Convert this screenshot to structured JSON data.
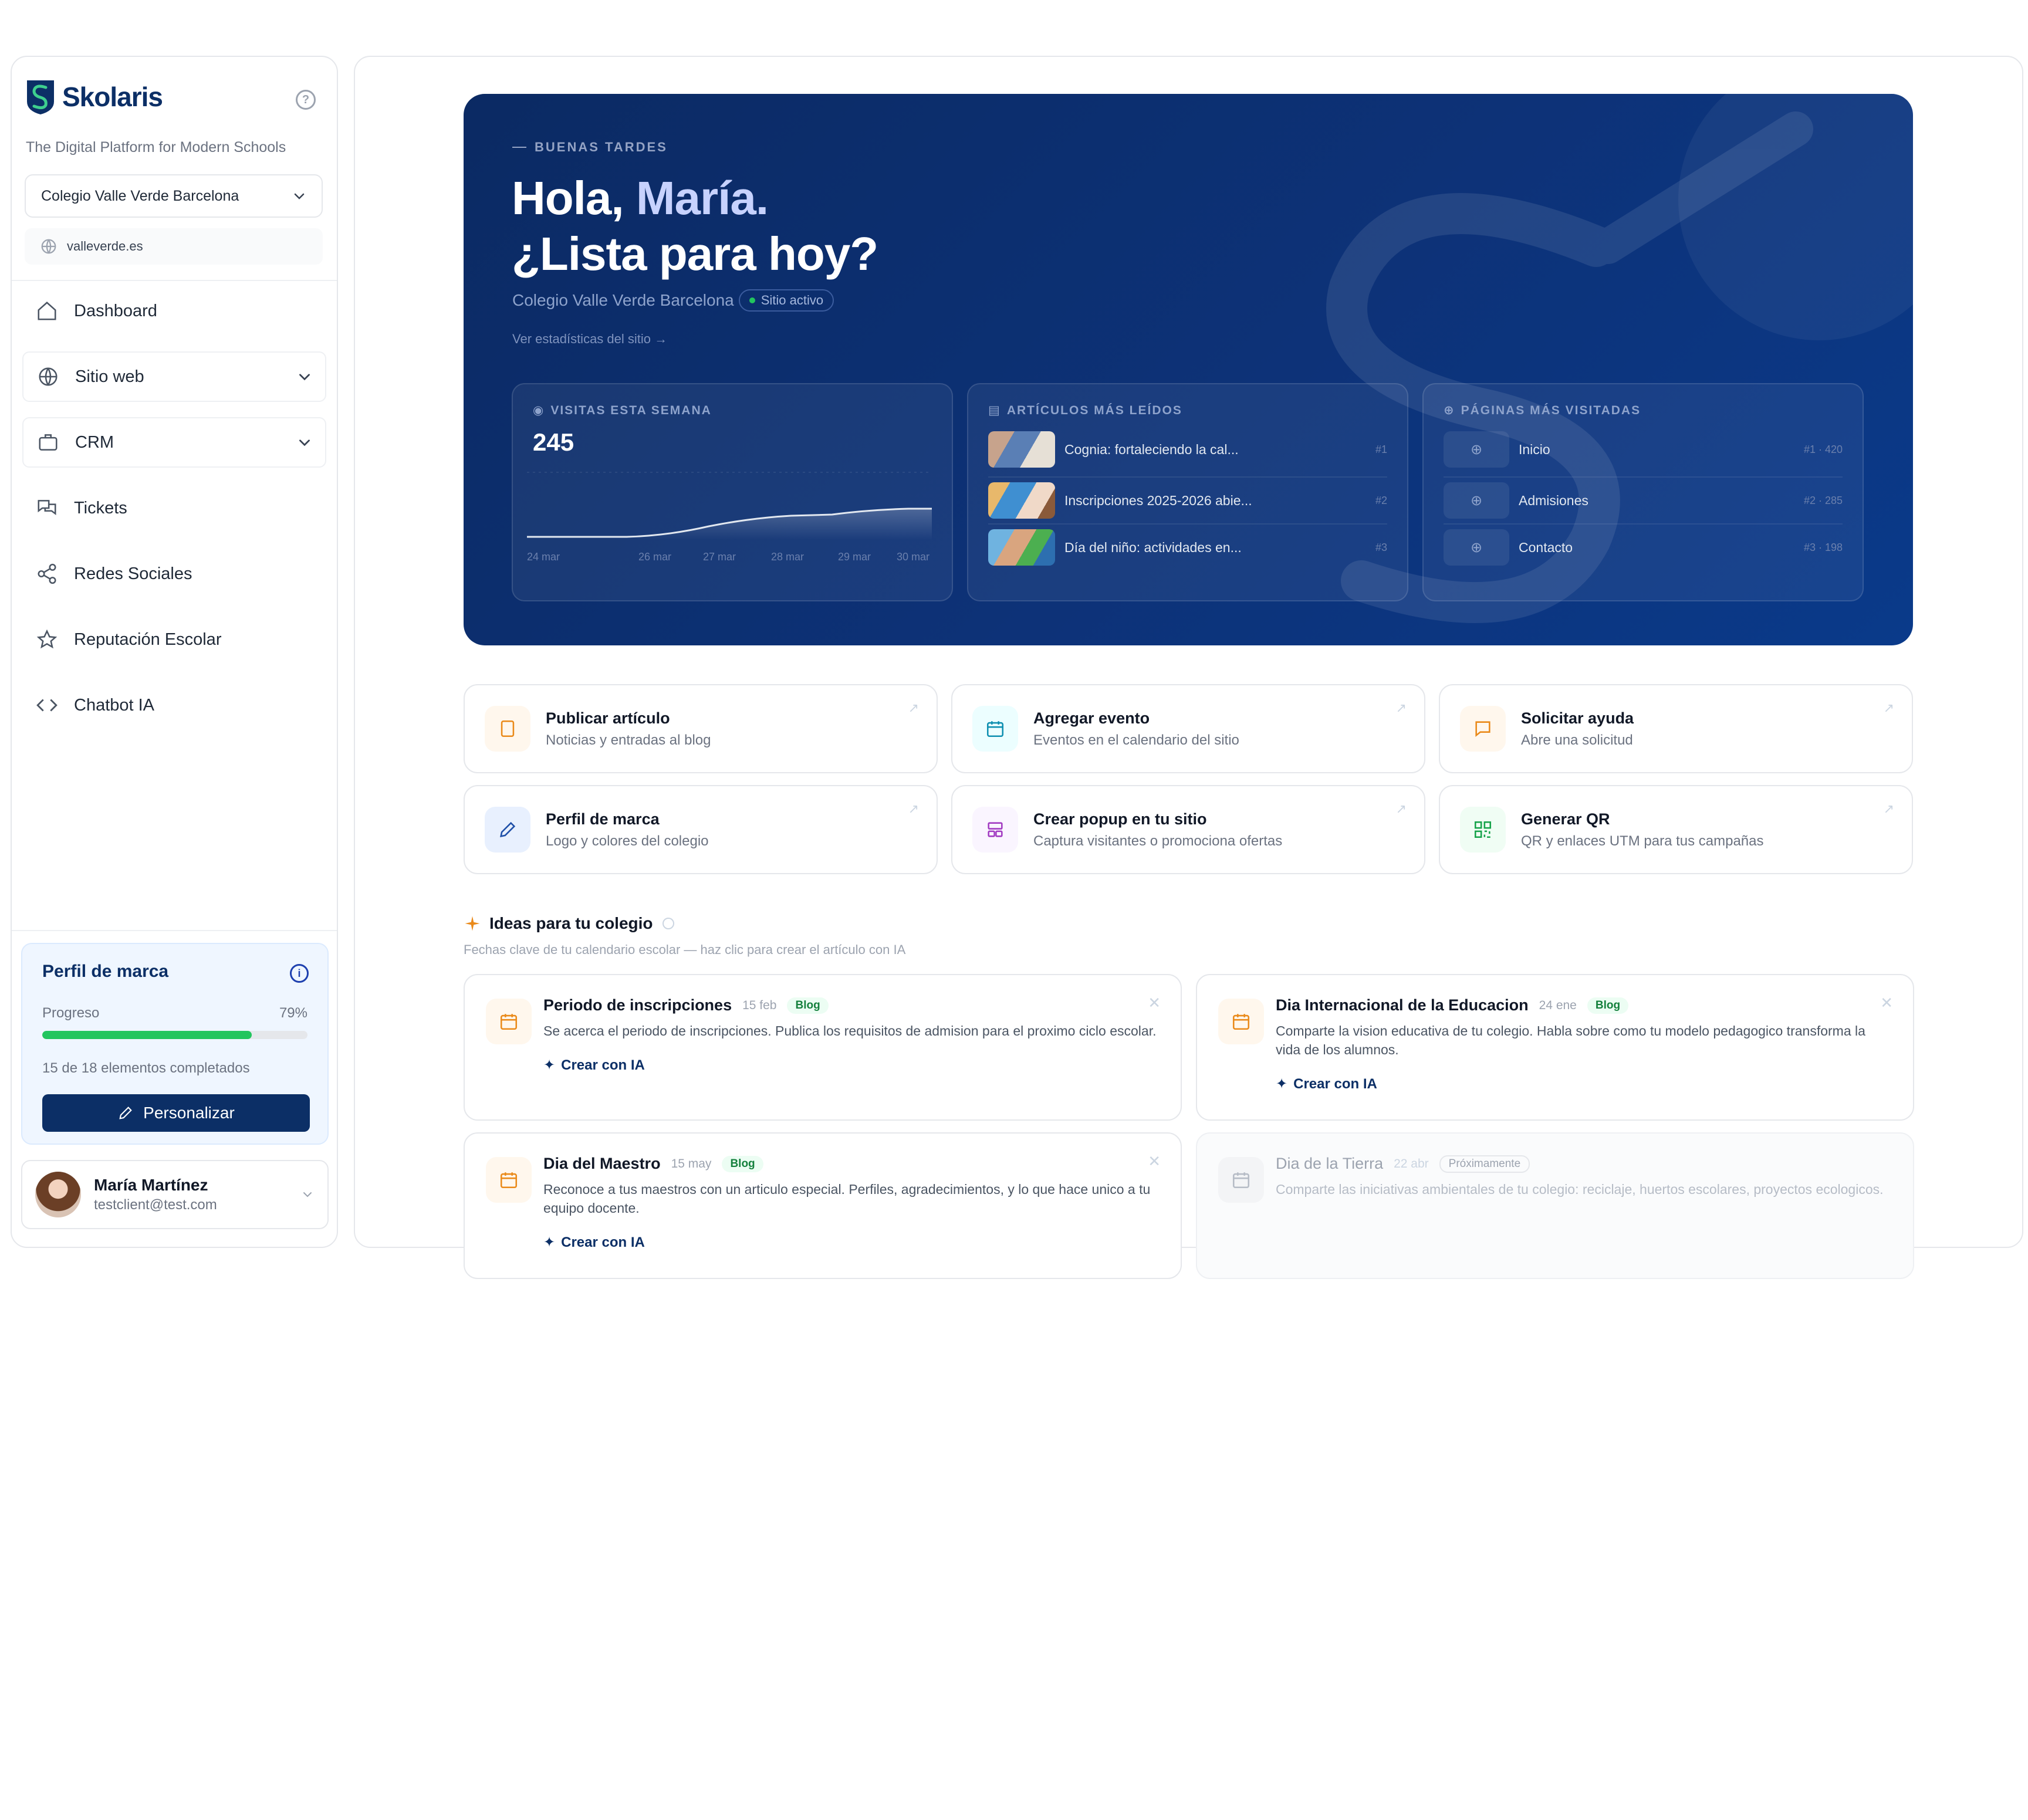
{
  "sidebar": {
    "brand": "Skolaris",
    "tagline": "The Digital Platform for Modern Schools",
    "school": "Colegio Valle Verde Barcelona",
    "domain": "valleverde.es",
    "help_glyph": "?",
    "nav": [
      {
        "label": "Dashboard",
        "icon": "home-icon"
      },
      {
        "label": "Sitio web",
        "icon": "globe-icon",
        "expandable": true
      },
      {
        "label": "CRM",
        "icon": "briefcase-icon",
        "expandable": true
      },
      {
        "label": "Tickets",
        "icon": "chat-icon"
      },
      {
        "label": "Redes Sociales",
        "icon": "share-icon"
      },
      {
        "label": "Reputación Escolar",
        "icon": "star-icon"
      },
      {
        "label": "Chatbot IA",
        "icon": "code-icon"
      }
    ],
    "brand_profile": {
      "title": "Perfil de marca",
      "progress_label": "Progreso",
      "progress_pct": "79%",
      "progress_value": 0.79,
      "completed": "15 de 18 elementos completados",
      "button": "Personalizar"
    },
    "user": {
      "name": "María Martínez",
      "email": "testclient@test.com"
    }
  },
  "hero": {
    "eyebrow": "BUENAS TARDES",
    "greeting": "Hola,",
    "name": "María.",
    "question": "¿Lista para hoy?",
    "school": "Colegio Valle Verde Barcelona",
    "status": "Sitio activo",
    "stats_link": "Ver estadísticas del sitio",
    "visits": {
      "title": "VISITAS ESTA SEMANA",
      "value": "245",
      "x_labels": [
        "24 mar",
        "26 mar",
        "27 mar",
        "28 mar",
        "29 mar",
        "30 mar"
      ]
    },
    "articles": {
      "title": "ARTÍCULOS MÁS LEÍDOS",
      "items": [
        {
          "title": "Cognia: fortaleciendo la cal...",
          "rank": "#1"
        },
        {
          "title": "Inscripciones 2025-2026 abie...",
          "rank": "#2"
        },
        {
          "title": "Día del niño: actividades en...",
          "rank": "#3"
        }
      ]
    },
    "pages": {
      "title": "PÁGINAS MÁS VISITADAS",
      "items": [
        {
          "title": "Inicio",
          "rank": "#1 · 420"
        },
        {
          "title": "Admisiones",
          "rank": "#2 · 285"
        },
        {
          "title": "Contacto",
          "rank": "#3 · 198"
        }
      ]
    }
  },
  "quick_actions": [
    {
      "title": "Publicar artículo",
      "desc": "Noticias y entradas al blog",
      "icon": "document-icon",
      "color": "#ea8a1a",
      "bg": "#fff7ed"
    },
    {
      "title": "Agregar evento",
      "desc": "Eventos en el calendario del sitio",
      "icon": "calendar-icon",
      "color": "#0e8fb0",
      "bg": "#ecfeff"
    },
    {
      "title": "Solicitar ayuda",
      "desc": "Abre una solicitud",
      "icon": "message-icon",
      "color": "#ea8a1a",
      "bg": "#fff7ed"
    },
    {
      "title": "Perfil de marca",
      "desc": "Logo y colores del colegio",
      "icon": "brush-icon",
      "color": "#1e4fa8",
      "bg": "#e8f0fe"
    },
    {
      "title": "Crear popup en tu sitio",
      "desc": "Captura visitantes o promociona ofertas",
      "icon": "layout-icon",
      "color": "#a23cc2",
      "bg": "#faf5ff"
    },
    {
      "title": "Generar QR",
      "desc": "QR y enlaces UTM para tus campañas",
      "icon": "qr-icon",
      "color": "#16a34a",
      "bg": "#f0fdf4"
    }
  ],
  "ideas": {
    "title": "Ideas para tu colegio",
    "subtitle": "Fechas clave de tu calendario escolar — haz clic para crear el artículo con IA",
    "cta": "Crear con IA",
    "items": [
      {
        "title": "Periodo de inscripciones",
        "date": "15 feb",
        "badge": "Blog",
        "desc": "Se acerca el periodo de inscripciones. Publica los requisitos de admision para el proximo ciclo escolar."
      },
      {
        "title": "Dia Internacional de la Educacion",
        "date": "24 ene",
        "badge": "Blog",
        "desc": "Comparte la vision educativa de tu colegio. Habla sobre como tu modelo pedagogico transforma la vida de los alumnos."
      },
      {
        "title": "Dia del Maestro",
        "date": "15 may",
        "badge": "Blog",
        "desc": "Reconoce a tus maestros con un articulo especial. Perfiles, agradecimientos, y lo que hace unico a tu equipo docente."
      },
      {
        "title": "Dia de la Tierra",
        "date": "22 abr",
        "badge": "Próximamente",
        "desc": "Comparte las iniciativas ambientales de tu colegio: reciclaje, huertos escolares, proyectos ecologicos."
      }
    ]
  }
}
